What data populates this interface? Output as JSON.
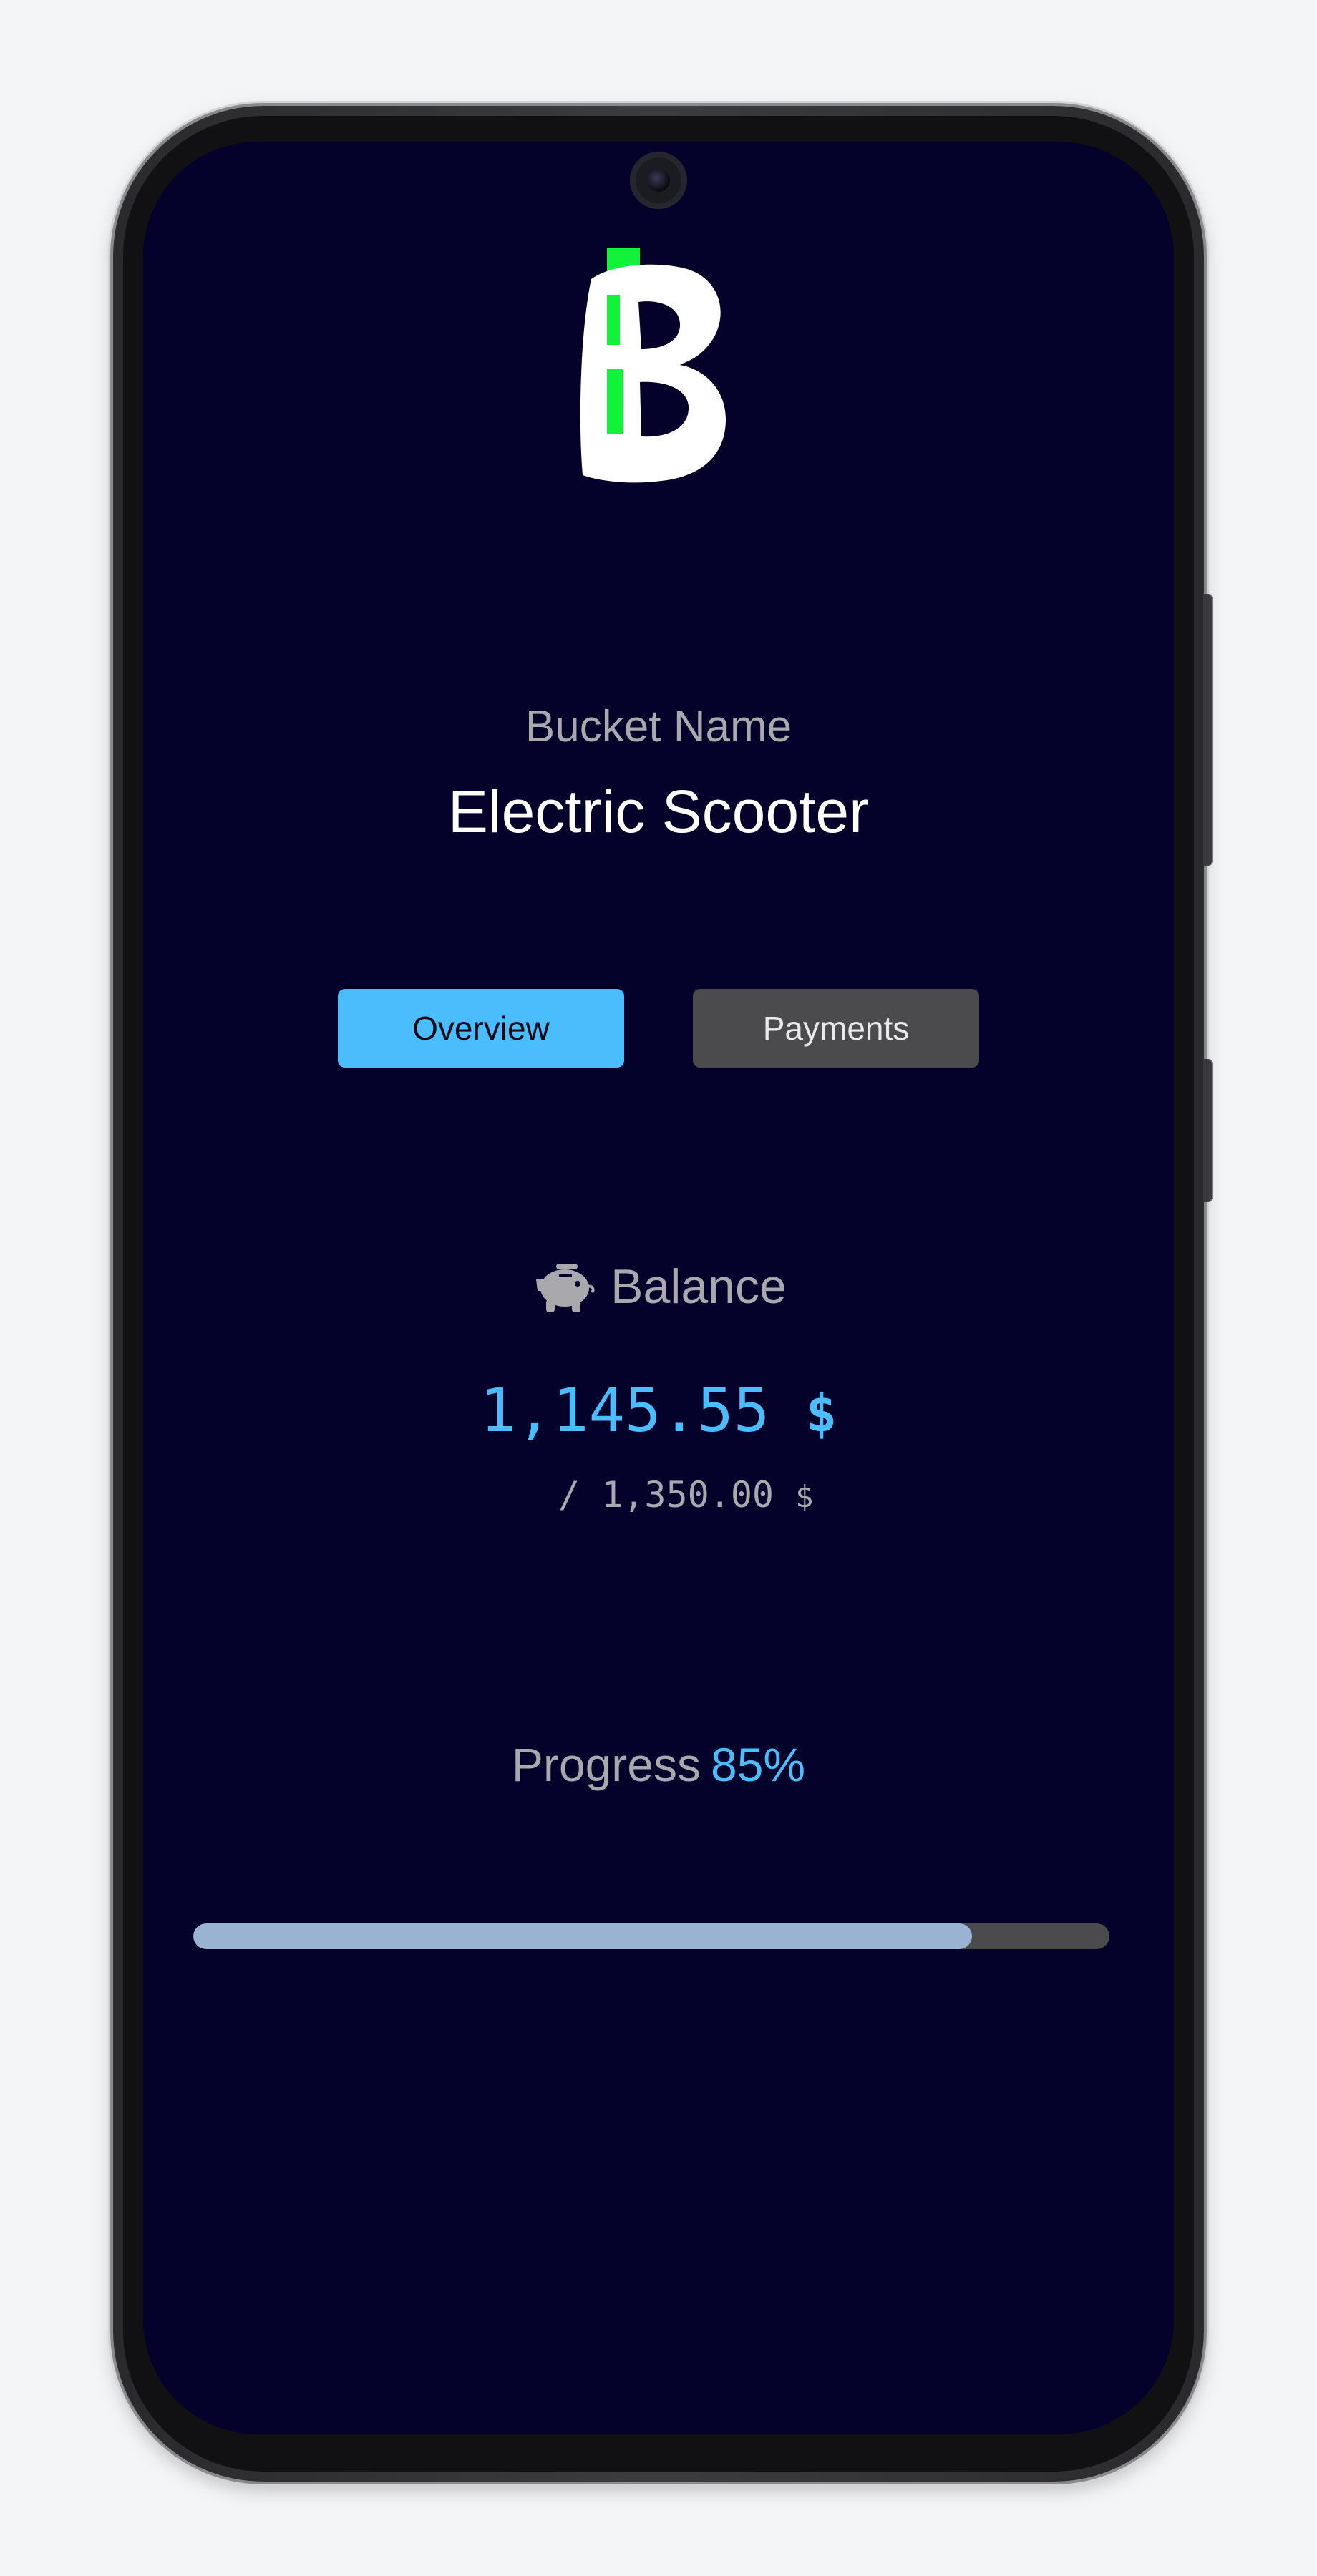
{
  "app": {
    "logo_letter": "B",
    "accent_color": "#4bbdfd",
    "logo_bar_color": "#11f23a",
    "background_color": "#04022b"
  },
  "bucket": {
    "label": "Bucket Name",
    "name": "Electric Scooter"
  },
  "tabs": [
    {
      "label": "Overview",
      "active": true
    },
    {
      "label": "Payments",
      "active": false
    }
  ],
  "balance": {
    "icon": "piggy-bank-icon",
    "label": "Balance",
    "amount": "1,145.55",
    "currency": "$",
    "target_prefix": "/",
    "target_amount": "1,350.00",
    "target_currency": "$"
  },
  "progress": {
    "label": "Progress",
    "value_text": "85%",
    "fraction": 0.85
  }
}
